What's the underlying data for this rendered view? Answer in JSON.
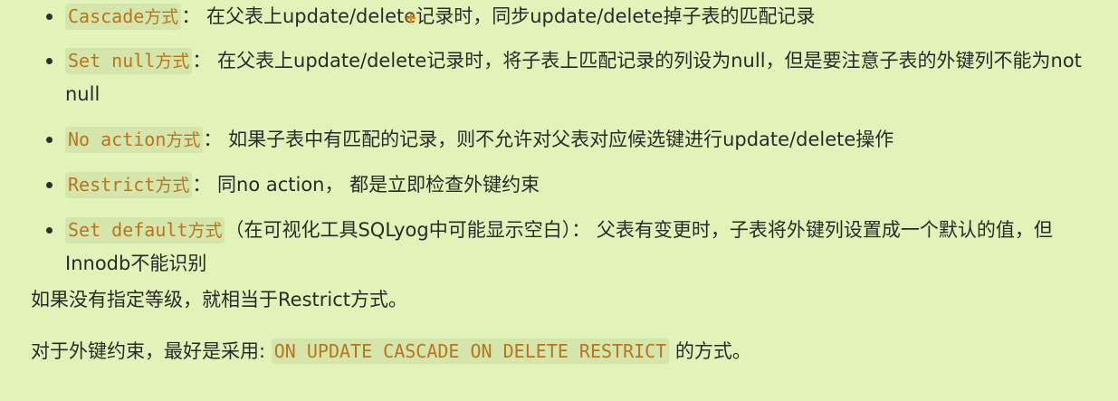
{
  "items": [
    {
      "code": "Cascade",
      "suffix": "方式",
      "desc": "： 在父表上update/delete记录时，同步update/delete掉子表的匹配记录"
    },
    {
      "code": "Set null",
      "suffix": "方式",
      "desc": "： 在父表上update/delete记录时，将子表上匹配记录的列设为null，但是要注意子表的外键列不能为not null"
    },
    {
      "code": "No action",
      "suffix": "方式",
      "desc": "： 如果子表中有匹配的记录，则不允许对父表对应候选键进行update/delete操作"
    },
    {
      "code": "Restrict",
      "suffix": "方式",
      "desc": "： 同no action， 都是立即检查外键约束"
    },
    {
      "code": "Set default",
      "suffix": "方式",
      "desc": "（在可视化工具SQLyog中可能显示空白）： 父表有变更时，子表将外键列设置成一个默认的值，但Innodb不能识别"
    }
  ],
  "paragraph1": "如果没有指定等级，就相当于Restrict方式。",
  "paragraph2": {
    "prefix": "对于外键约束，最好是采用: ",
    "code": "ON UPDATE CASCADE ON DELETE RESTRICT",
    "suffix": " 的方式。"
  },
  "colors": {
    "background": "#e1f3b9",
    "code_text": "#b7751e",
    "code_background": "#d5e6ad",
    "body_text": "#2a2a2a"
  }
}
